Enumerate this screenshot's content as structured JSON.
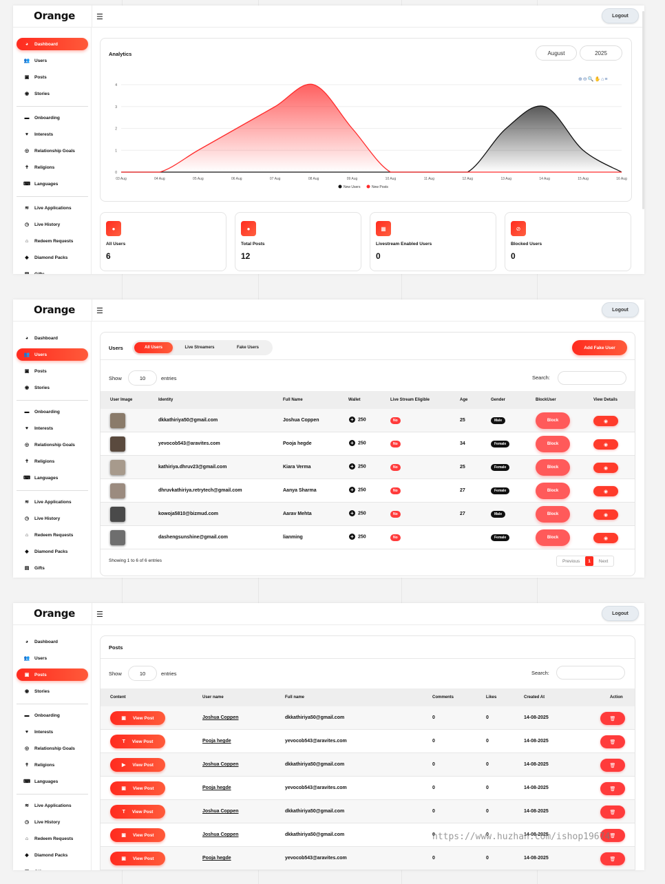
{
  "brand": {
    "logo": "Orange",
    "accent": "#ff2b1f"
  },
  "header": {
    "logout": "Logout"
  },
  "sidebar": {
    "items": [
      {
        "label": "Dashboard",
        "icon": "dashboard-icon"
      },
      {
        "label": "Users",
        "icon": "users-icon"
      },
      {
        "label": "Posts",
        "icon": "posts-icon"
      },
      {
        "label": "Stories",
        "icon": "stories-icon"
      },
      {
        "label": "Onboarding",
        "icon": "onboarding-icon"
      },
      {
        "label": "Interests",
        "icon": "heart-icon"
      },
      {
        "label": "Relationship Goals",
        "icon": "target-icon"
      },
      {
        "label": "Religions",
        "icon": "cross-icon"
      },
      {
        "label": "Languages",
        "icon": "language-icon"
      },
      {
        "label": "Live Applications",
        "icon": "rss-icon"
      },
      {
        "label": "Live History",
        "icon": "history-icon"
      },
      {
        "label": "Redeem Requests",
        "icon": "bank-icon"
      },
      {
        "label": "Diamond Packs",
        "icon": "diamond-icon"
      },
      {
        "label": "Gifts",
        "icon": "gift-icon"
      }
    ]
  },
  "dashboard": {
    "analytics_title": "Analytics",
    "month": "August",
    "year": "2025",
    "chart_toolbar": "⊕⊖🔍✋⌂≡",
    "stats": [
      {
        "label": "All Users",
        "value": "6",
        "icon": "user-icon"
      },
      {
        "label": "Total Posts",
        "value": "12",
        "icon": "user-icon"
      },
      {
        "label": "Livestream Enabled Users",
        "value": "0",
        "icon": "calendar-icon"
      },
      {
        "label": "Blocked Users",
        "value": "0",
        "icon": "ban-icon"
      }
    ]
  },
  "chart_data": {
    "type": "area",
    "categories": [
      "03 Aug",
      "04 Aug",
      "05 Aug",
      "06 Aug",
      "07 Aug",
      "08 Aug",
      "09 Aug",
      "10 Aug",
      "11 Aug",
      "12 Aug",
      "13 Aug",
      "14 Aug",
      "15 Aug",
      "16 Aug"
    ],
    "y_ticks": [
      "0",
      "1",
      "2",
      "3",
      "4"
    ],
    "ylim": [
      0,
      4
    ],
    "series": [
      {
        "name": "New Users",
        "color": "#111111",
        "values": [
          0,
          0,
          0,
          0,
          0,
          0,
          0,
          0,
          0,
          0,
          2,
          3,
          1,
          0
        ]
      },
      {
        "name": "New Posts",
        "color": "#ff2b2b",
        "values": [
          0,
          0,
          1,
          2,
          3,
          4,
          2,
          0,
          0,
          0,
          0,
          0,
          0,
          0
        ]
      }
    ],
    "legend": "bottom",
    "grid": true
  },
  "users_page": {
    "title": "Users",
    "tabs": [
      "All Users",
      "Live Streamers",
      "Fake Users"
    ],
    "add_fake": "Add Fake User",
    "show_label": "Show",
    "show_value": "10",
    "entries_label": "entries",
    "search_label": "Search:",
    "columns": [
      "User Image",
      "Identity",
      "Full Name",
      "Wallet",
      "Live Stream Eligible",
      "Age",
      "Gender",
      "BlockUser",
      "View Details"
    ],
    "rows": [
      {
        "identity": "dkkathiriya50@gmail.com",
        "name": "Joshua Coppen",
        "wallet": "250",
        "eligible": "No",
        "age": "25",
        "gender": "Male",
        "block": "Block"
      },
      {
        "identity": "yevocob543@aravites.com",
        "name": "Pooja hegde",
        "wallet": "250",
        "eligible": "No",
        "age": "34",
        "gender": "Female",
        "block": "Block"
      },
      {
        "identity": "kathiriya.dhruv23@gmail.com",
        "name": "Kiara Verma",
        "wallet": "250",
        "eligible": "No",
        "age": "25",
        "gender": "Female",
        "block": "Block"
      },
      {
        "identity": "dhruvkathiriya.retrytech@gmail.com",
        "name": "Aanya Sharma",
        "wallet": "250",
        "eligible": "No",
        "age": "27",
        "gender": "Female",
        "block": "Block"
      },
      {
        "identity": "kowoja5810@bizmud.com",
        "name": "Aarav Mehta",
        "wallet": "250",
        "eligible": "No",
        "age": "27",
        "gender": "Male",
        "block": "Block"
      },
      {
        "identity": "dashengsunshine@gmail.com",
        "name": "lianming",
        "wallet": "250",
        "eligible": "No",
        "age": "",
        "gender": "Female",
        "block": "Block"
      }
    ],
    "info": "Showing 1 to 6 of 6 entries",
    "prev": "Previous",
    "page": "1",
    "next": "Next"
  },
  "posts_page": {
    "title": "Posts",
    "show_label": "Show",
    "show_value": "10",
    "entries_label": "entries",
    "search_label": "Search:",
    "columns": [
      "Content",
      "User name",
      "Full name",
      "Comments",
      "Likes",
      "Created At",
      "Action"
    ],
    "view_post": "View Post",
    "rows": [
      {
        "type_icon": "image-icon",
        "user": "Joshua Coppen",
        "full": "dkkathiriya50@gmail.com",
        "comments": "0",
        "likes": "0",
        "created": "14-08-2025"
      },
      {
        "type_icon": "text-icon",
        "user": "Pooja hegde",
        "full": "yevocob543@aravites.com",
        "comments": "0",
        "likes": "0",
        "created": "14-08-2025"
      },
      {
        "type_icon": "video-icon",
        "user": "Joshua Coppen",
        "full": "dkkathiriya50@gmail.com",
        "comments": "0",
        "likes": "0",
        "created": "14-08-2025"
      },
      {
        "type_icon": "image-icon",
        "user": "Pooja hegde",
        "full": "yevocob543@aravites.com",
        "comments": "0",
        "likes": "0",
        "created": "14-08-2025"
      },
      {
        "type_icon": "text-icon",
        "user": "Joshua Coppen",
        "full": "dkkathiriya50@gmail.com",
        "comments": "0",
        "likes": "0",
        "created": "14-08-2025"
      },
      {
        "type_icon": "image-icon",
        "user": "Joshua Coppen",
        "full": "dkkathiriya50@gmail.com",
        "comments": "0",
        "likes": "0",
        "created": "14-08-2025"
      },
      {
        "type_icon": "image-icon",
        "user": "Pooja hegde",
        "full": "yevocob543@aravites.com",
        "comments": "0",
        "likes": "0",
        "created": "14-08-2025"
      }
    ]
  },
  "watermark": "https://www.huzhan.com/ishop19674"
}
